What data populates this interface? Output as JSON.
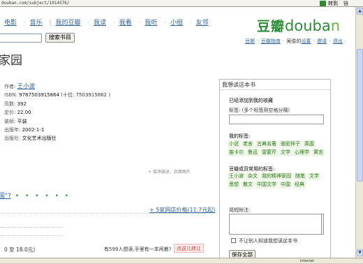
{
  "browser": {
    "url": "douban.com/subject/1014576/",
    "go_label": "转到",
    "links_label": "链"
  },
  "nav": {
    "items": [
      "电影",
      "音乐"
    ],
    "items2": [
      "我的豆瓣",
      "我读",
      "我看",
      "我听",
      "小组",
      "友邻"
    ],
    "search_button": "搜索书目"
  },
  "logo": {
    "cn": "豆瓣",
    "en_1": "douba",
    "en_2": "n"
  },
  "user_links": {
    "home": "豆邮",
    "guide": "豆瓣指南",
    "name_label": "·",
    "user_text": "吴俊的",
    "settings": "设置",
    "invite": "邀请",
    "logout": "退出"
  },
  "book": {
    "title": "家园",
    "author_label": "作者:",
    "author": "王小波",
    "isbn_label": "ISBN:",
    "isbn": "9787503915864",
    "isbn_sub": "(十位: 7503915862 )",
    "pages_label": "页数:",
    "pages": "392",
    "price_label": "定价:",
    "price": "22.00",
    "binding_label": "装帧:",
    "binding": "平装",
    "pubdate_label": "出版年:",
    "pubdate": "2002-1-1",
    "publisher_label": "出版社:",
    "publisher": "文化艺术出版社"
  },
  "main": {
    "cover_link": "+ 增添描述、封面图片",
    "promo": "国\"?",
    "promo_dots": "• • • • • •",
    "store_link": "+ 5家网店价格(11.7元起)",
    "price_range": "0 至 18.0元)",
    "wanters": "有599人想读,手里有一本闲着?",
    "point_button": "点这儿转让"
  },
  "panel": {
    "header": "我想读这本书",
    "added": "已经添加到我的收藏",
    "tags_label": "标签: (多个标签用空格分隔)",
    "my_tags_title": "我的标签:",
    "my_tags": [
      "小说",
      "老舍",
      "古典名著",
      "骆驼祥子",
      "英国",
      "笛卡尔",
      "鲁迅",
      "雷蒙芹",
      "文学",
      "心理学",
      "寓言"
    ],
    "common_tags_title": "豆瓣成员常用的标签:",
    "common_tags": [
      "王小波",
      "杂文",
      "我的精神家园",
      "随笔",
      "文学",
      "思想",
      "散文",
      "中国文学",
      "中国",
      "经典"
    ],
    "note_label": "简短附注:",
    "private_label": "不让别人知道我想读这本书",
    "save_button": "保存全部"
  },
  "status": {
    "zone": "Internet"
  }
}
